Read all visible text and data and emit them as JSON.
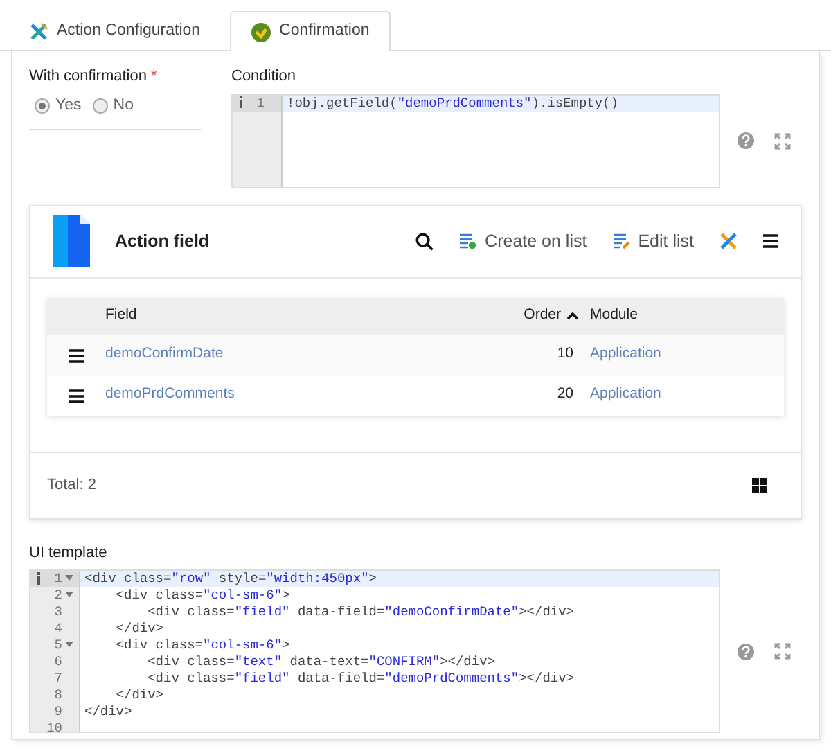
{
  "tabs": [
    {
      "label": "Action Configuration",
      "selected": false,
      "kind": "tools"
    },
    {
      "label": "Confirmation",
      "selected": true,
      "kind": "check"
    }
  ],
  "confirmation": {
    "label": "With confirmation",
    "required_mark": "*",
    "options": [
      {
        "label": "Yes",
        "selected": true
      },
      {
        "label": "No",
        "selected": false
      }
    ]
  },
  "condition": {
    "label": "Condition",
    "lines": [
      {
        "number": "1",
        "text": "!obj.getField(\"demoPrdComments\").isEmpty()",
        "active": true,
        "foldable": false
      }
    ]
  },
  "list": {
    "title": "Action field",
    "actions": [
      {
        "label": "Create on list",
        "kind": "create"
      },
      {
        "label": "Edit list",
        "kind": "edit"
      }
    ],
    "columns": [
      {
        "label": "Field",
        "sorted": false
      },
      {
        "label": "Order",
        "sorted": true
      },
      {
        "label": "Module",
        "sorted": false
      }
    ],
    "rows": [
      {
        "field": "demoConfirmDate",
        "order": "10",
        "module": "Application"
      },
      {
        "field": "demoPrdComments",
        "order": "20",
        "module": "Application"
      }
    ],
    "total": "Total: 2"
  },
  "ui_template": {
    "label": "UI template",
    "lines": [
      {
        "number": "1",
        "text": "<div class=\"row\" style=\"width:450px\">",
        "active": true,
        "foldable": true
      },
      {
        "number": "2",
        "text": "    <div class=\"col-sm-6\">",
        "active": false,
        "foldable": true
      },
      {
        "number": "3",
        "text": "        <div class=\"field\" data-field=\"demoConfirmDate\"></div>",
        "active": false,
        "foldable": false
      },
      {
        "number": "4",
        "text": "    </div>",
        "active": false,
        "foldable": false
      },
      {
        "number": "5",
        "text": "    <div class=\"col-sm-6\">",
        "active": false,
        "foldable": true
      },
      {
        "number": "6",
        "text": "        <div class=\"text\" data-text=\"CONFIRM\"></div>",
        "active": false,
        "foldable": false
      },
      {
        "number": "7",
        "text": "        <div class=\"field\" data-field=\"demoPrdComments\"></div>",
        "active": false,
        "foldable": false
      },
      {
        "number": "8",
        "text": "    </div>",
        "active": false,
        "foldable": false
      },
      {
        "number": "9",
        "text": "</div>",
        "active": false,
        "foldable": false
      },
      {
        "number": "10",
        "active": false,
        "foldable": false
      }
    ]
  }
}
